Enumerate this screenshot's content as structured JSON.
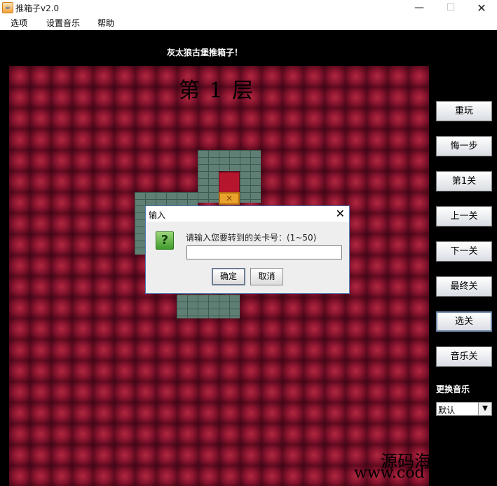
{
  "window": {
    "title": "推箱子v2.0",
    "minimize_glyph": "—",
    "maximize_glyph": "☐",
    "close_glyph": "✕"
  },
  "menu": {
    "items": [
      "选项",
      "设置音乐",
      "帮助"
    ]
  },
  "headline": "灰太狼古堡推箱子！",
  "level_title": "第 1 层",
  "dialog": {
    "title": "输入",
    "close_glyph": "✕",
    "icon_glyph": "?",
    "prompt": "请输入您要转到的关卡号：(1~50)",
    "input_value": "",
    "ok": "确定",
    "cancel": "取消"
  },
  "side_buttons": [
    "重玩",
    "悔一步",
    "第1关",
    "上一关",
    "下一关",
    "最终关",
    "选关",
    "音乐关"
  ],
  "music": {
    "label": "更换音乐",
    "selected": "默认",
    "chevron": "▼"
  },
  "crate_glyph": "✕",
  "watermark": {
    "line1": "源码海",
    "line2": "www.cod"
  },
  "colors": {
    "board": "#7a0f28",
    "wall": "#5f7f74",
    "crate": "#e9a22b",
    "dialog_border": "#4d79b5"
  }
}
